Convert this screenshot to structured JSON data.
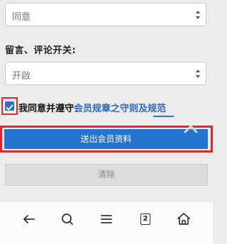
{
  "form": {
    "select1_value": "同意",
    "comment_label": "留言、评论开关:",
    "select2_value": "开啟",
    "agree_prefix": "我同意并遵守",
    "agree_link": "会员规章之守则及规范",
    "submit_label": "送出会员资料",
    "clear_label": "清除"
  },
  "checkbox": {
    "checked": true
  },
  "toolbar": {
    "tabs_count": "2"
  },
  "icons": {
    "select_arrows": "updown-arrows-icon",
    "scroll_top": "chevron-up-icon",
    "back": "arrow-left-icon",
    "search": "search-icon",
    "menu": "menu-icon",
    "tabs": "tabs-icon",
    "home": "home-icon"
  },
  "colors": {
    "primary_button": "#2374cf",
    "link": "#2c68c2",
    "highlight_outline": "#e0262f",
    "checkbox": "#2f6fc1",
    "clear_button": "#dcdcdc",
    "background": "#ececec"
  }
}
